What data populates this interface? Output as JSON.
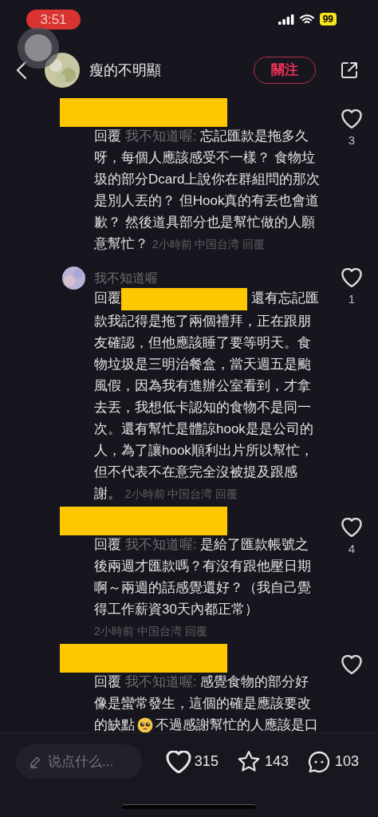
{
  "status_bar": {
    "time": "3:51",
    "battery": "99"
  },
  "header": {
    "author": "瘦的不明顯",
    "follow_button": "關注"
  },
  "comments": [
    {
      "kind": "reply",
      "reply_label": "回覆",
      "mention": "我不知道喔:",
      "text": "忘記匯款是拖多久呀，每個人應該感受不一樣？ 食物垃圾的部分Dcard上說你在群組問的那次是別人丟的？ 但Hook真的有丟也會道歉？ 然後道具部分也是幫忙做的人願意幫忙？",
      "time": "2小時前",
      "location": "中国台湾",
      "reply_link": "回覆",
      "likes": "3"
    },
    {
      "kind": "named_reply",
      "author": "我不知道喔",
      "reply_label": "回覆",
      "text": "還有忘記匯款我記得是拖了兩個禮拜，正在跟朋友確認，但他應該睡了要等明天。食物垃圾是三明治餐盒，當天週五是颱風假，因為我有進辦公室看到，才拿去丟，我想低卡認知的食物不是同一次。還有幫忙是體諒hook是是公司的人，為了讓hook順利出片所以幫忙，但不代表不在意完全沒被提及跟感謝。",
      "time": "2小時前",
      "location": "中国台湾",
      "reply_link": "回覆",
      "likes": "1"
    },
    {
      "kind": "reply",
      "reply_label": "回覆",
      "mention": "我不知道喔:",
      "text": "是給了匯款帳號之後兩週才匯款嗎？有沒有跟他壓日期啊～兩週的話感覺還好？（我自己覺得工作薪資30天內都正常）",
      "time": "2小時前",
      "location": "中国台湾",
      "reply_link": "回覆",
      "likes": "4"
    },
    {
      "kind": "reply",
      "reply_label": "回覆",
      "mention": "我不知道喔:",
      "text": "感覺食物的部分好像是蠻常發生，這個的確是應該要改的缺點",
      "emoji": true,
      "text_after": "不過感謝幫忙的人應該是口"
    }
  ],
  "bottom_bar": {
    "placeholder": "说点什么...",
    "likes": "315",
    "favorites": "143",
    "comments": "103"
  }
}
